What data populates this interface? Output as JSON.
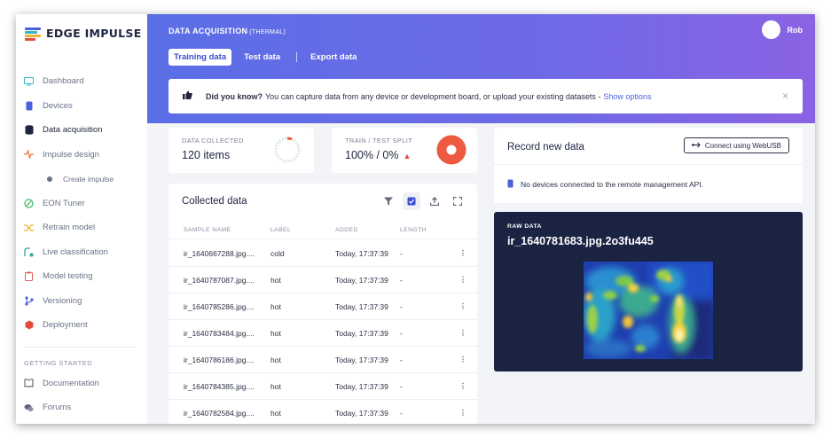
{
  "app": {
    "name": "EDGE IMPULSE"
  },
  "sidebar": {
    "items": [
      {
        "label": "Dashboard",
        "icon": "monitor-icon",
        "color": "#36b3c9"
      },
      {
        "label": "Devices",
        "icon": "device-icon",
        "color": "#4a61dd"
      },
      {
        "label": "Data acquisition",
        "icon": "database-icon",
        "color": "#1f2540"
      },
      {
        "label": "Impulse design",
        "icon": "pulse-icon",
        "color": "#f07a3c"
      },
      {
        "label": "Create impulse",
        "icon": "dot-icon",
        "color": "#6a7287"
      },
      {
        "label": "EON Tuner",
        "icon": "tuner-icon",
        "color": "#4cb86a"
      },
      {
        "label": "Retrain model",
        "icon": "shuffle-icon",
        "color": "#f0b132"
      },
      {
        "label": "Live classification",
        "icon": "live-icon",
        "color": "#2aa59b"
      },
      {
        "label": "Model testing",
        "icon": "clipboard-icon",
        "color": "#e85c63"
      },
      {
        "label": "Versioning",
        "icon": "branch-icon",
        "color": "#4a61dd"
      },
      {
        "label": "Deployment",
        "icon": "cube-icon",
        "color": "#e44b3f"
      }
    ],
    "getting_started_heading": "GETTING STARTED",
    "help_items": [
      {
        "label": "Documentation",
        "icon": "book-icon"
      },
      {
        "label": "Forums",
        "icon": "chat-icon"
      }
    ]
  },
  "header": {
    "title": "DATA ACQUISITION",
    "title_suffix": "(THERMAL)",
    "tabs": [
      {
        "label": "Training data",
        "active": true
      },
      {
        "label": "Test data",
        "active": false
      },
      {
        "label": "Export data",
        "active": false
      }
    ],
    "user_name": "Rob"
  },
  "banner": {
    "bold": "Did you know?",
    "text": "You can capture data from any device or development board, or upload your existing datasets -",
    "link": "Show options",
    "close": "×"
  },
  "stats": {
    "collected_label": "DATA COLLECTED",
    "collected_value": "120 items",
    "split_label": "TRAIN / TEST SPLIT",
    "split_value": "100% / 0%",
    "split_train_fraction": 1.0,
    "accent_color": "#ee5a3f"
  },
  "collected": {
    "title": "Collected data",
    "columns": [
      "SAMPLE NAME",
      "LABEL",
      "ADDED",
      "LENGTH"
    ],
    "rows": [
      {
        "name": "ir_1640667288.jpg....",
        "label": "cold",
        "added": "Today, 17:37:39",
        "length": "-"
      },
      {
        "name": "ir_1640787087.jpg....",
        "label": "hot",
        "added": "Today, 17:37:39",
        "length": "-"
      },
      {
        "name": "ir_1640785286.jpg....",
        "label": "hot",
        "added": "Today, 17:37:39",
        "length": "-"
      },
      {
        "name": "ir_1640783484.jpg....",
        "label": "hot",
        "added": "Today, 17:37:39",
        "length": "-"
      },
      {
        "name": "ir_1640786186.jpg....",
        "label": "hot",
        "added": "Today, 17:37:39",
        "length": "-"
      },
      {
        "name": "ir_1640784385.jpg....",
        "label": "hot",
        "added": "Today, 17:37:39",
        "length": "-"
      },
      {
        "name": "ir_1640782584.jpg....",
        "label": "hot",
        "added": "Today, 17:37:39",
        "length": "-"
      }
    ],
    "row_menu": "⋮"
  },
  "record": {
    "title": "Record new data",
    "button": "Connect using WebUSB",
    "no_devices": "No devices connected to the remote management API."
  },
  "raw": {
    "label": "RAW DATA",
    "name": "ir_1640781683.jpg.2o3fu445"
  }
}
